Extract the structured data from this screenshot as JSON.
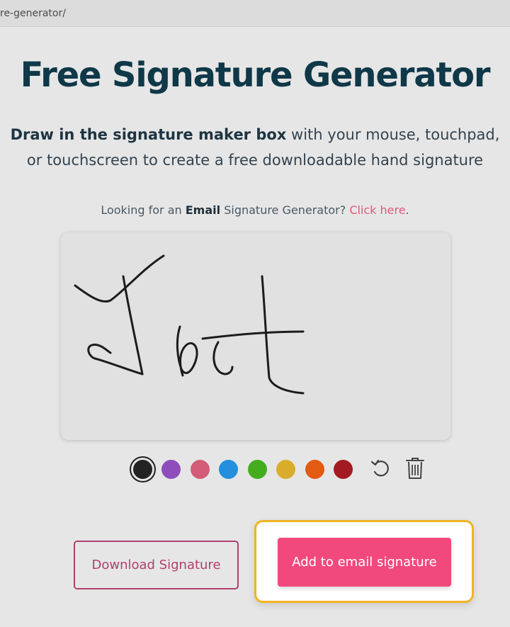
{
  "browser": {
    "url": "re-generator/"
  },
  "header": {
    "title": "Free Signature Generator",
    "desc_bold": "Draw in the signature maker box",
    "desc_rest": " with your mouse, touchpad,",
    "desc_line2": "or touchscreen to create a free downloadable hand signature"
  },
  "email_prompt": {
    "prefix": "Looking for an ",
    "bold": "Email",
    "middle": " Signature Generator? ",
    "link": "Click here",
    "suffix": "."
  },
  "signature_pad": {
    "drawn_text": "Jest",
    "ink_color": "#1c1c1c"
  },
  "palette": {
    "selected": "black",
    "colors": [
      {
        "name": "black",
        "hex": "#232323"
      },
      {
        "name": "purple",
        "hex": "#8e4dbb"
      },
      {
        "name": "pink",
        "hex": "#d35c78"
      },
      {
        "name": "blue",
        "hex": "#238fdd"
      },
      {
        "name": "green",
        "hex": "#44ad1e"
      },
      {
        "name": "yellow",
        "hex": "#d9ad2b"
      },
      {
        "name": "orange",
        "hex": "#e35b12"
      },
      {
        "name": "red",
        "hex": "#a31b22"
      }
    ]
  },
  "tools": {
    "undo_icon": "undo-icon",
    "delete_icon": "trash-icon"
  },
  "actions": {
    "download_label": "Download Signature",
    "email_label": "Add to email signature"
  },
  "colors": {
    "title": "#0f3848",
    "accent": "#f2497d",
    "outline_button": "#b0416e",
    "highlight_border": "#f1b323"
  }
}
